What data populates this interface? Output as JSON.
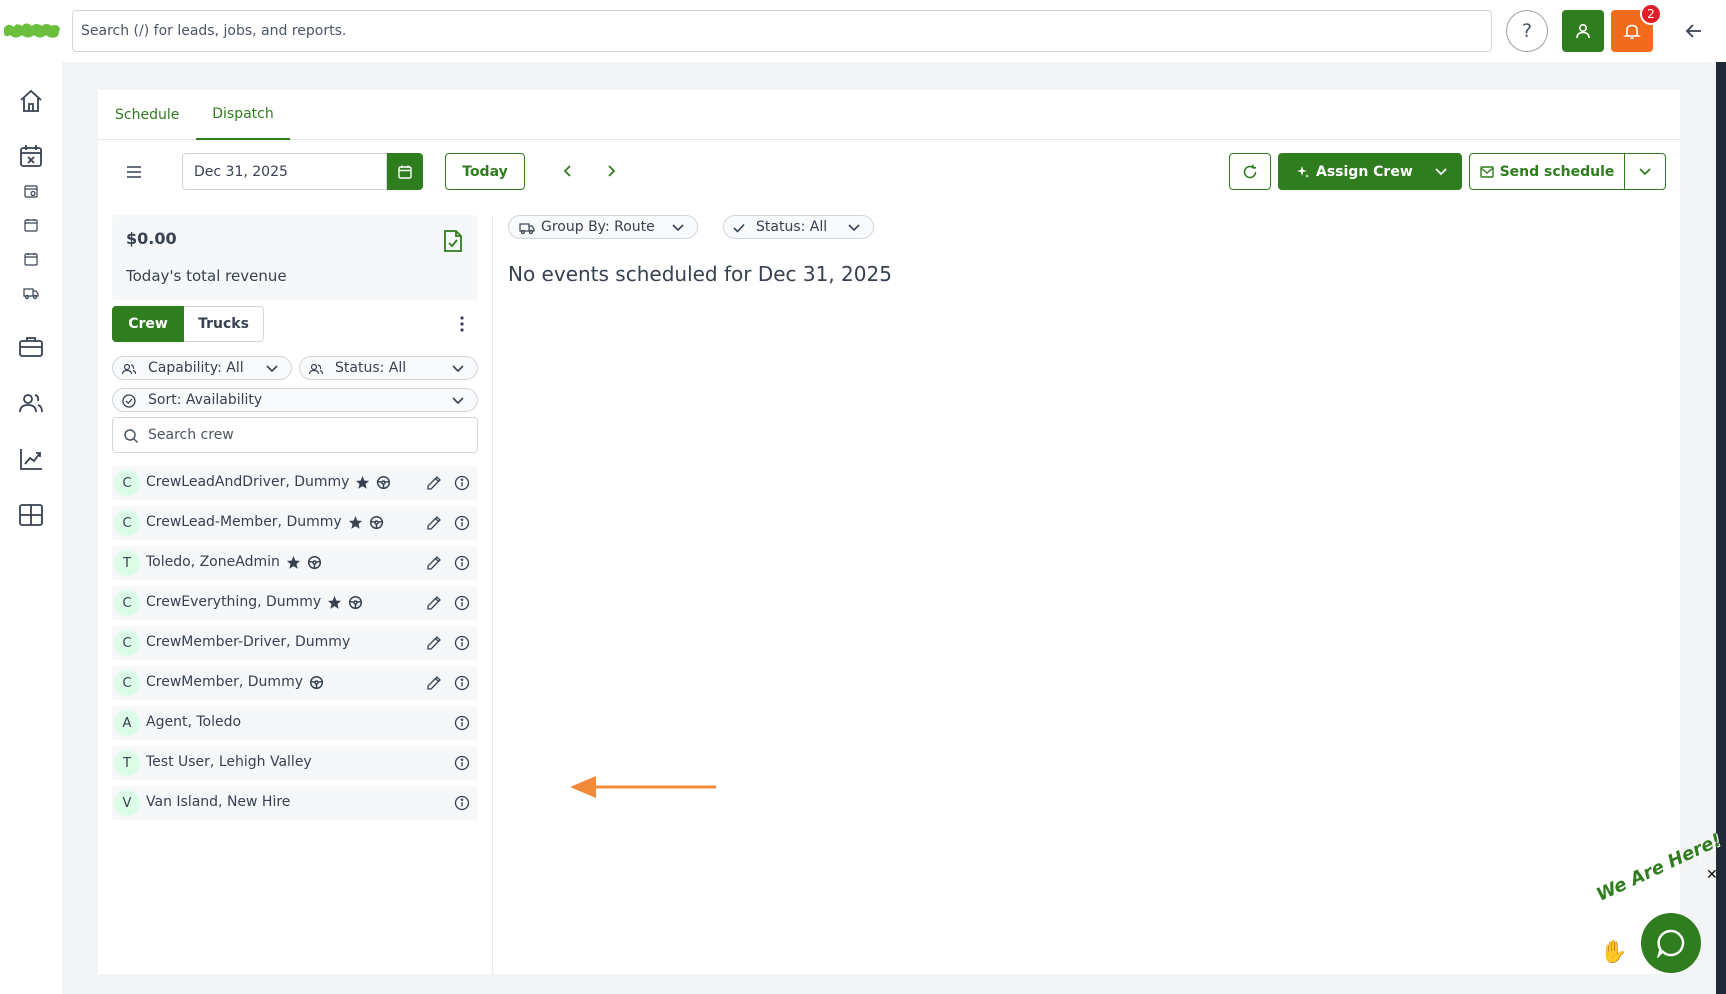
{
  "topbar": {
    "search_placeholder": "Search (/) for leads, jobs, and reports.",
    "help_label": "?",
    "notification_count": "2"
  },
  "tabs": [
    {
      "label": "Schedule",
      "active": false
    },
    {
      "label": "Dispatch",
      "active": true
    }
  ],
  "toolbar": {
    "date_value": "Dec 31, 2025",
    "today_label": "Today",
    "assign_label": "Assign Crew",
    "send_label": "Send schedule"
  },
  "revenue": {
    "amount": "$0.00",
    "label": "Today's total revenue"
  },
  "segments": {
    "crew": "Crew",
    "trucks": "Trucks"
  },
  "filters": {
    "capability": "Capability: All",
    "status": "Status: All",
    "sort": "Sort: Availability",
    "search_placeholder": "Search crew"
  },
  "crew": [
    {
      "initial": "C",
      "name": "CrewLeadAndDriver, Dummy",
      "star": true,
      "wheel": true,
      "editable": true
    },
    {
      "initial": "C",
      "name": "CrewLead-Member, Dummy",
      "star": true,
      "wheel": true,
      "editable": true
    },
    {
      "initial": "T",
      "name": "Toledo, ZoneAdmin",
      "star": true,
      "wheel": true,
      "editable": true
    },
    {
      "initial": "C",
      "name": "CrewEverything, Dummy",
      "star": true,
      "wheel": true,
      "editable": true
    },
    {
      "initial": "C",
      "name": "CrewMember-Driver, Dummy",
      "star": false,
      "wheel": false,
      "editable": true
    },
    {
      "initial": "C",
      "name": "CrewMember, Dummy",
      "star": false,
      "wheel": true,
      "editable": true
    },
    {
      "initial": "A",
      "name": "Agent, Toledo",
      "star": false,
      "wheel": false,
      "editable": false
    },
    {
      "initial": "T",
      "name": "Test User, Lehigh Valley",
      "star": false,
      "wheel": false,
      "editable": false
    },
    {
      "initial": "V",
      "name": "Van Island, New Hire",
      "star": false,
      "wheel": false,
      "editable": false
    }
  ],
  "dispatch": {
    "group_by": "Group By: Route",
    "status": "Status: All",
    "empty_message": "No events scheduled for Dec 31, 2025"
  },
  "chat": {
    "tagline": "We Are Here!",
    "close": "✕"
  },
  "colors": {
    "brand_green": "#2f7d1f",
    "notification_orange": "#f26b1d",
    "badge_red": "#e11d2a",
    "annotation_arrow": "#f08a3a"
  }
}
